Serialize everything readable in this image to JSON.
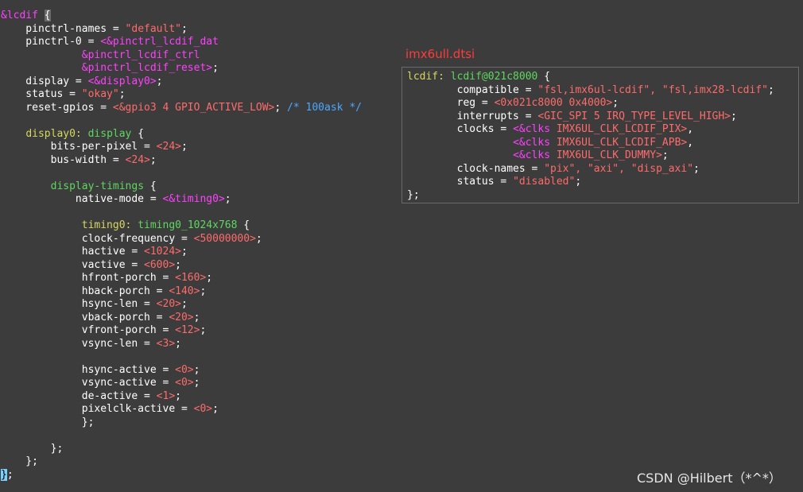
{
  "colors": {
    "background": "#3c3c3c",
    "default": "#ffffff",
    "string": "#ff6b6b",
    "phandle": "#ff40ff",
    "label": "#d7d75f",
    "node_name": "#5fd75f",
    "comment": "#4aa8ff",
    "popup_title": "#ff3b3b"
  },
  "editor": {
    "lines": [
      [
        {
          "t": "&lcdif ",
          "c": "phandle"
        },
        {
          "t": "{",
          "c": "default",
          "hl": "brace"
        }
      ],
      [
        {
          "t": "    pinctrl-names = ",
          "c": "default"
        },
        {
          "t": "\"default\"",
          "c": "string"
        },
        {
          "t": ";",
          "c": "default"
        }
      ],
      [
        {
          "t": "    pinctrl-0 = ",
          "c": "default"
        },
        {
          "t": "<&pinctrl_lcdif_dat",
          "c": "phandle"
        }
      ],
      [
        {
          "t": "             &pinctrl_lcdif_ctrl",
          "c": "phandle"
        }
      ],
      [
        {
          "t": "             &pinctrl_lcdif_reset>",
          "c": "phandle"
        },
        {
          "t": ";",
          "c": "default"
        }
      ],
      [
        {
          "t": "    display = ",
          "c": "default"
        },
        {
          "t": "<&display0>",
          "c": "phandle"
        },
        {
          "t": ";",
          "c": "default"
        }
      ],
      [
        {
          "t": "    status = ",
          "c": "default"
        },
        {
          "t": "\"okay\"",
          "c": "string"
        },
        {
          "t": ";",
          "c": "default"
        }
      ],
      [
        {
          "t": "    reset-gpios = ",
          "c": "default"
        },
        {
          "t": "<&gpio3 4 GPIO_ACTIVE_LOW>",
          "c": "string"
        },
        {
          "t": "; ",
          "c": "default"
        },
        {
          "t": "/* 100ask */",
          "c": "comment"
        }
      ],
      [],
      [
        {
          "t": "    ",
          "c": "default"
        },
        {
          "t": "display0:",
          "c": "label"
        },
        {
          "t": " display ",
          "c": "node_name"
        },
        {
          "t": "{",
          "c": "default"
        }
      ],
      [
        {
          "t": "        bits-per-pixel = ",
          "c": "default"
        },
        {
          "t": "<24>",
          "c": "string"
        },
        {
          "t": ";",
          "c": "default"
        }
      ],
      [
        {
          "t": "        bus-width = ",
          "c": "default"
        },
        {
          "t": "<24>",
          "c": "string"
        },
        {
          "t": ";",
          "c": "default"
        }
      ],
      [],
      [
        {
          "t": "        ",
          "c": "default"
        },
        {
          "t": "display-timings",
          "c": "node_name"
        },
        {
          "t": " {",
          "c": "default"
        }
      ],
      [
        {
          "t": "            native-mode = ",
          "c": "default"
        },
        {
          "t": "<&timing0>",
          "c": "phandle"
        },
        {
          "t": ";",
          "c": "default"
        }
      ],
      [],
      [
        {
          "t": "             ",
          "c": "default"
        },
        {
          "t": "timing0:",
          "c": "label"
        },
        {
          "t": " timing0_1024x768 ",
          "c": "node_name"
        },
        {
          "t": "{",
          "c": "default"
        }
      ],
      [
        {
          "t": "             clock-frequency = ",
          "c": "default"
        },
        {
          "t": "<50000000>",
          "c": "string"
        },
        {
          "t": ";",
          "c": "default"
        }
      ],
      [
        {
          "t": "             hactive = ",
          "c": "default"
        },
        {
          "t": "<1024>",
          "c": "string"
        },
        {
          "t": ";",
          "c": "default"
        }
      ],
      [
        {
          "t": "             vactive = ",
          "c": "default"
        },
        {
          "t": "<600>",
          "c": "string"
        },
        {
          "t": ";",
          "c": "default"
        }
      ],
      [
        {
          "t": "             hfront-porch = ",
          "c": "default"
        },
        {
          "t": "<160>",
          "c": "string"
        },
        {
          "t": ";",
          "c": "default"
        }
      ],
      [
        {
          "t": "             hback-porch = ",
          "c": "default"
        },
        {
          "t": "<140>",
          "c": "string"
        },
        {
          "t": ";",
          "c": "default"
        }
      ],
      [
        {
          "t": "             hsync-len = ",
          "c": "default"
        },
        {
          "t": "<20>",
          "c": "string"
        },
        {
          "t": ";",
          "c": "default"
        }
      ],
      [
        {
          "t": "             vback-porch = ",
          "c": "default"
        },
        {
          "t": "<20>",
          "c": "string"
        },
        {
          "t": ";",
          "c": "default"
        }
      ],
      [
        {
          "t": "             vfront-porch = ",
          "c": "default"
        },
        {
          "t": "<12>",
          "c": "string"
        },
        {
          "t": ";",
          "c": "default"
        }
      ],
      [
        {
          "t": "             vsync-len = ",
          "c": "default"
        },
        {
          "t": "<3>",
          "c": "string"
        },
        {
          "t": ";",
          "c": "default"
        }
      ],
      [],
      [
        {
          "t": "             hsync-active = ",
          "c": "default"
        },
        {
          "t": "<0>",
          "c": "string"
        },
        {
          "t": ";",
          "c": "default"
        }
      ],
      [
        {
          "t": "             vsync-active = ",
          "c": "default"
        },
        {
          "t": "<0>",
          "c": "string"
        },
        {
          "t": ";",
          "c": "default"
        }
      ],
      [
        {
          "t": "             de-active = ",
          "c": "default"
        },
        {
          "t": "<1>",
          "c": "string"
        },
        {
          "t": ";",
          "c": "default"
        }
      ],
      [
        {
          "t": "             pixelclk-active = ",
          "c": "default"
        },
        {
          "t": "<0>",
          "c": "string"
        },
        {
          "t": ";",
          "c": "default"
        }
      ],
      [
        {
          "t": "             };",
          "c": "default"
        }
      ],
      [],
      [
        {
          "t": "        };",
          "c": "default"
        }
      ],
      [
        {
          "t": "    };",
          "c": "default"
        }
      ],
      [
        {
          "t": "}",
          "c": "default",
          "hl": "cursor"
        },
        {
          "t": ";",
          "c": "default"
        }
      ]
    ]
  },
  "popup": {
    "title": "imx6ull.dtsi",
    "lines": [
      [
        {
          "t": "lcdif:",
          "c": "label"
        },
        {
          "t": " lcdif@021c8000 ",
          "c": "node_name"
        },
        {
          "t": "{",
          "c": "default"
        }
      ],
      [
        {
          "t": "        compatible = ",
          "c": "default"
        },
        {
          "t": "\"fsl,imx6ul-lcdif\", \"fsl,imx28-lcdif\"",
          "c": "string"
        },
        {
          "t": ";",
          "c": "default"
        }
      ],
      [
        {
          "t": "        reg = ",
          "c": "default"
        },
        {
          "t": "<0x021c8000 0x4000>",
          "c": "string"
        },
        {
          "t": ";",
          "c": "default"
        }
      ],
      [
        {
          "t": "        interrupts = ",
          "c": "default"
        },
        {
          "t": "<GIC_SPI 5 IRQ_TYPE_LEVEL_HIGH>",
          "c": "string"
        },
        {
          "t": ";",
          "c": "default"
        }
      ],
      [
        {
          "t": "        clocks = ",
          "c": "default"
        },
        {
          "t": "<&clks",
          "c": "phandle"
        },
        {
          "t": " IMX6UL_CLK_LCDIF_PIX>",
          "c": "string"
        },
        {
          "t": ",",
          "c": "default"
        }
      ],
      [
        {
          "t": "                 ",
          "c": "default"
        },
        {
          "t": "<&clks",
          "c": "phandle"
        },
        {
          "t": " IMX6UL_CLK_LCDIF_APB>",
          "c": "string"
        },
        {
          "t": ",",
          "c": "default"
        }
      ],
      [
        {
          "t": "                 ",
          "c": "default"
        },
        {
          "t": "<&clks",
          "c": "phandle"
        },
        {
          "t": " IMX6UL_CLK_DUMMY>",
          "c": "string"
        },
        {
          "t": ";",
          "c": "default"
        }
      ],
      [
        {
          "t": "        clock-names = ",
          "c": "default"
        },
        {
          "t": "\"pix\", \"axi\", \"disp_axi\"",
          "c": "string"
        },
        {
          "t": ";",
          "c": "default"
        }
      ],
      [
        {
          "t": "        status = ",
          "c": "default"
        },
        {
          "t": "\"disabled\"",
          "c": "string"
        },
        {
          "t": ";",
          "c": "default"
        }
      ],
      [
        {
          "t": "};",
          "c": "default"
        }
      ]
    ]
  },
  "watermark": {
    "text": "CSDN @Hilbert（*^*）"
  }
}
